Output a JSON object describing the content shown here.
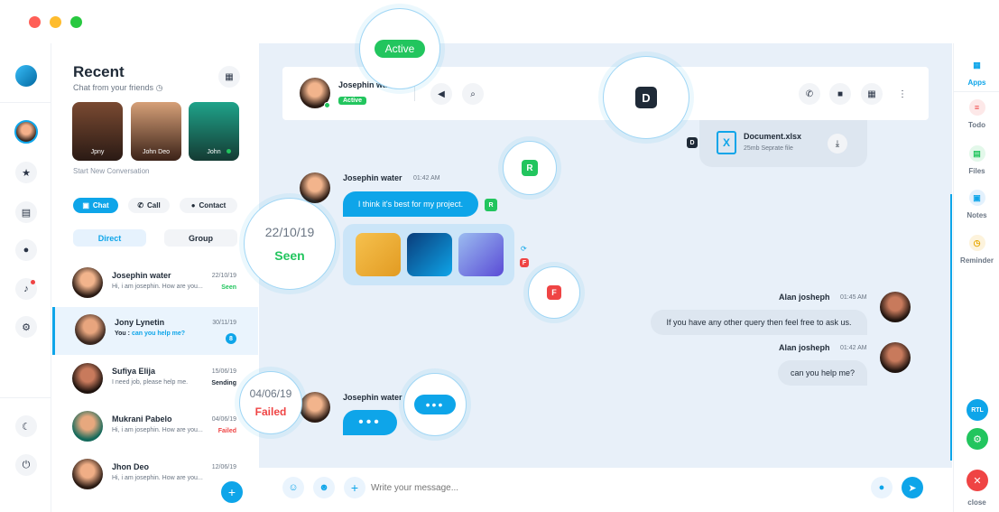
{
  "colors": {
    "accent": "#0ea5e9",
    "green": "#22c55e",
    "red": "#ef4444",
    "chat_bg": "#e8f0f9"
  },
  "sidebar": {
    "title": "Recent",
    "subtitle": "Chat from your friends",
    "stories": [
      {
        "name": "Jpny"
      },
      {
        "name": "John Deo"
      },
      {
        "name": "John"
      }
    ],
    "start_new": "Start New Conversation",
    "pills": {
      "chat": "Chat",
      "call": "Call",
      "contact": "Contact"
    },
    "segments": {
      "direct": "Direct",
      "group": "Group"
    },
    "conversations": [
      {
        "name": "Josephin water",
        "message": "Hi, i am josephin. How are you...",
        "date": "22/10/19",
        "status": "Seen"
      },
      {
        "name": "Jony Lynetin",
        "message_prefix": "You :",
        "message": "can you help me?",
        "date": "30/11/19",
        "badge": "8"
      },
      {
        "name": "Sufiya Elija",
        "message": "I need job, please help me.",
        "date": "15/06/19",
        "status": "Sending"
      },
      {
        "name": "Mukrani Pabelo",
        "message": "Hi, i am josephin. How are you...",
        "date": "04/06/19",
        "status": "Failed"
      },
      {
        "name": "Jhon Deo",
        "message": "Hi, i am josephin. How are you...",
        "date": "12/06/19"
      }
    ]
  },
  "header": {
    "contact_name": "Josephin water",
    "status_badge": "Active"
  },
  "messages": {
    "document": {
      "name": "Document.xlsx",
      "size": "25mb Seprate file"
    },
    "m1": {
      "sender": "Josephin water",
      "time": "01:42 AM",
      "text": "I think it's best for my project."
    },
    "m2": {
      "sender": "Alan josheph",
      "time": "01:45 AM",
      "text": "If you have any other query then feel free to ask us."
    },
    "m3": {
      "sender": "Alan josheph",
      "time": "01:42 AM",
      "text": "can you help me?"
    },
    "m4": {
      "sender": "Josephin water"
    }
  },
  "input": {
    "placeholder": "Write your message..."
  },
  "right_rail": {
    "apps": "Apps",
    "todo": "Todo",
    "files": "Files",
    "notes": "Notes",
    "reminder": "Reminder",
    "rtl": "RTL",
    "close": "close"
  },
  "zoom": {
    "active": "Active",
    "d_letter": "D",
    "r_letter": "R",
    "f_letter": "F",
    "seen_date": "22/10/19",
    "seen_label": "Seen",
    "failed_date": "04/06/19",
    "failed_label": "Failed",
    "mini_d": "D",
    "mini_r": "R",
    "mini_f": "F"
  }
}
